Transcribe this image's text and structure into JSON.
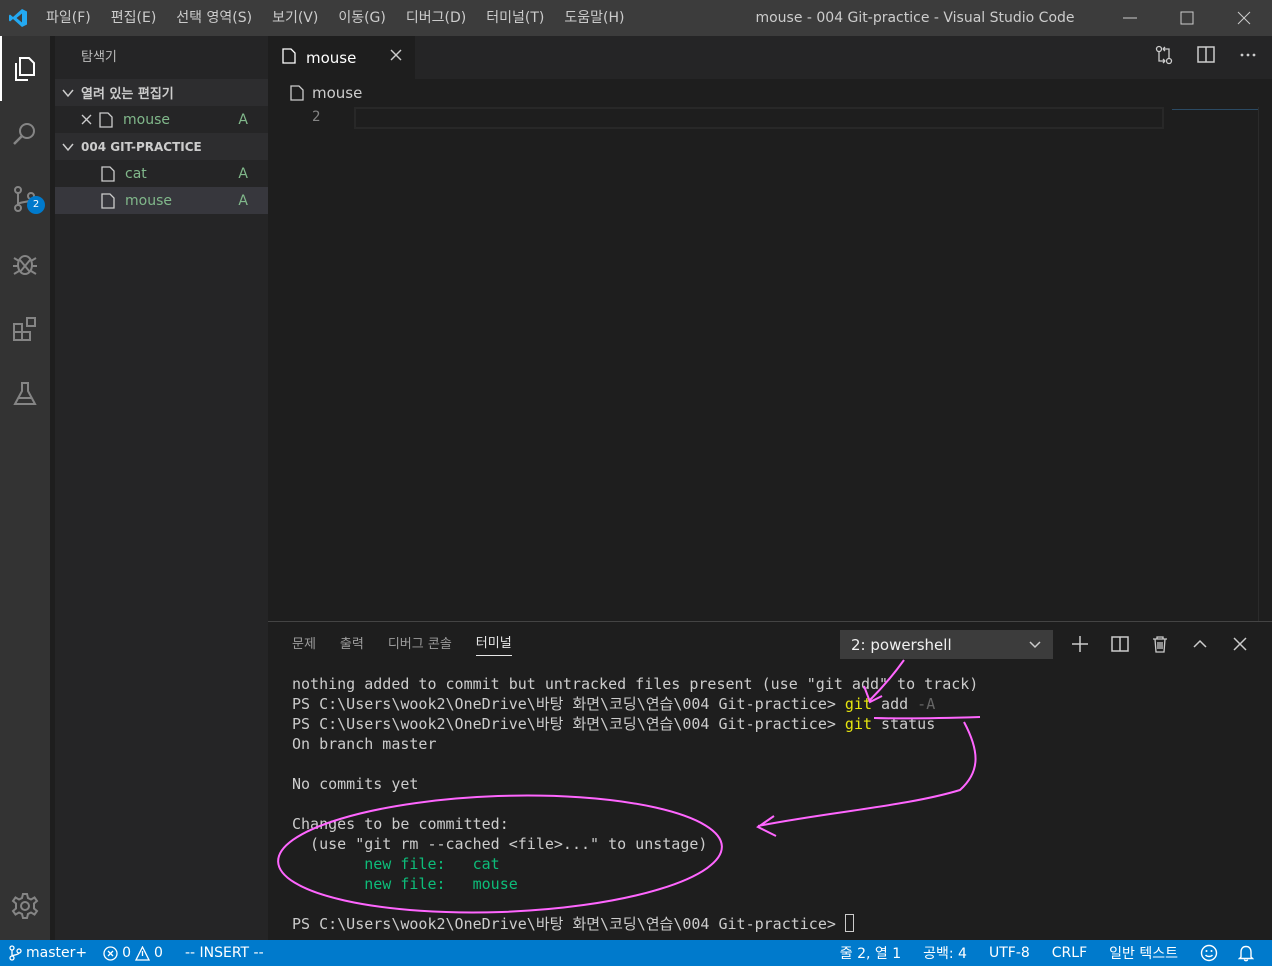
{
  "window": {
    "title": "mouse - 004 Git-practice - Visual Studio Code",
    "menu": [
      "파일(F)",
      "편집(E)",
      "선택 영역(S)",
      "보기(V)",
      "이동(G)",
      "디버그(D)",
      "터미널(T)",
      "도움말(H)"
    ]
  },
  "activitybar": {
    "scm_badge": "2"
  },
  "sidebar": {
    "title": "탐색기",
    "open_editors_header": "열려 있는 편집기",
    "open_editors": [
      {
        "label": "mouse",
        "status": "A"
      }
    ],
    "folder_header": "004 GIT-PRACTICE",
    "files": [
      {
        "label": "cat",
        "status": "A"
      },
      {
        "label": "mouse",
        "status": "A"
      }
    ]
  },
  "editor": {
    "tab_label": "mouse",
    "breadcrumb": "mouse",
    "line_number": "2"
  },
  "panel": {
    "tabs": [
      "문제",
      "출력",
      "디버그 콘솔",
      "터미널"
    ],
    "terminal_select": "2: powershell",
    "terminal": {
      "l1": "nothing added to commit but untracked files present (use \"git add\" to track)",
      "prompt": "PS C:\\Users\\wook2\\OneDrive\\바탕 화면\\코딩\\연습\\004 Git-practice> ",
      "cmd1_git": "git",
      "cmd1_rest": " add ",
      "cmd1_flag": "-A",
      "cmd2_git": "git",
      "cmd2_rest": " status",
      "l4": "On branch master",
      "l6": "No commits yet",
      "l8": "Changes to be committed:",
      "l9": "  (use \"git rm --cached <file>...\" to unstage)",
      "nf_label": "        new file:   ",
      "nf1": "cat",
      "nf2": "mouse"
    }
  },
  "statusbar": {
    "branch": "master+",
    "errors": "0",
    "warnings": "0",
    "mode": "-- INSERT --",
    "position": "줄 2, 열 1",
    "indent": "공백: 4",
    "encoding": "UTF-8",
    "eol": "CRLF",
    "language": "일반 텍스트"
  },
  "colors": {
    "accent": "#007acc",
    "git_added": "#81b88b",
    "annotation": "#ff66ff"
  }
}
